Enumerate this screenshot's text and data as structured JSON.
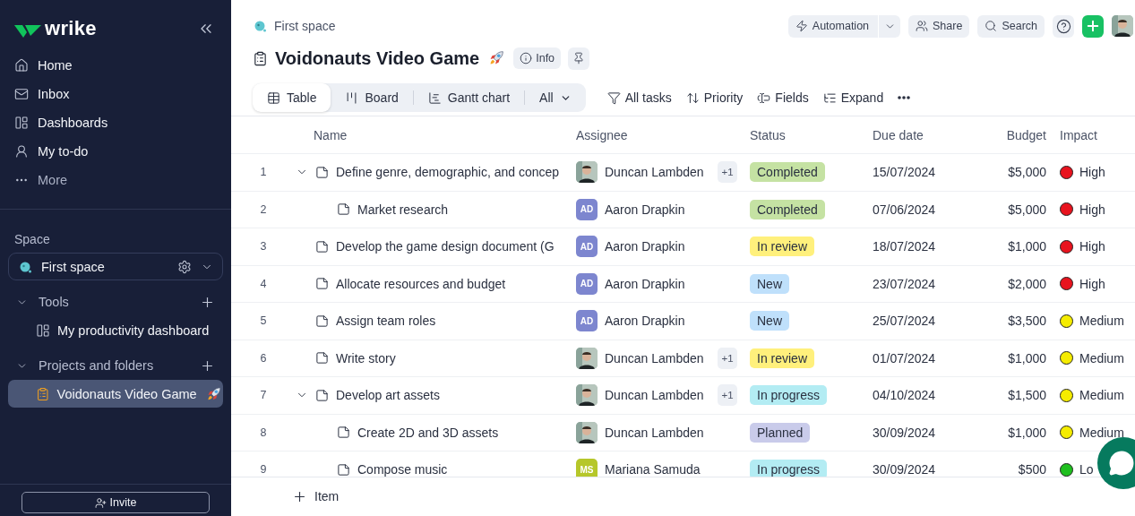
{
  "sidebar": {
    "brand": "wrike",
    "nav": [
      {
        "label": "Home",
        "kind": "home"
      },
      {
        "label": "Inbox",
        "kind": "inbox"
      },
      {
        "label": "Dashboards",
        "kind": "dashboards"
      },
      {
        "label": "My to-do",
        "kind": "todo"
      },
      {
        "label": "More",
        "kind": "more"
      }
    ],
    "space_heading": "Space",
    "space": "First space",
    "sections": [
      {
        "label": "Tools",
        "expanded": true,
        "children": [
          {
            "label": "My productivity dashboard",
            "kind": "dashboard",
            "selected": false
          }
        ]
      },
      {
        "label": "Projects and folders",
        "expanded": true,
        "children": [
          {
            "label": "Voidonauts Video Game",
            "kind": "project",
            "selected": true
          }
        ]
      }
    ],
    "invite": "Invite"
  },
  "header": {
    "breadcrumb": "First space",
    "title": "Voidonauts Video Game",
    "info": "Info",
    "actions": [
      {
        "label": "Automation",
        "kind": "automation"
      },
      {
        "label": "Share",
        "kind": "share"
      },
      {
        "label": "Search",
        "kind": "search"
      }
    ]
  },
  "view_tabs": [
    {
      "label": "Table",
      "kind": "table",
      "selected": true
    },
    {
      "label": "Board",
      "kind": "board",
      "selected": false
    },
    {
      "label": "Gantt chart",
      "kind": "gantt",
      "selected": false
    },
    {
      "label": "All",
      "kind": "menu",
      "selected": false
    }
  ],
  "toolbar": [
    {
      "label": "All tasks",
      "kind": "filter"
    },
    {
      "label": "Priority",
      "kind": "sort"
    },
    {
      "label": "Fields",
      "kind": "fields"
    },
    {
      "label": "Expand",
      "kind": "expand"
    }
  ],
  "table": {
    "columns": [
      "Name",
      "Assignee",
      "Status",
      "Due date",
      "Budget",
      "Impact"
    ],
    "rows": [
      {
        "num": "1",
        "name": "Define genre, demographic, and concep",
        "expanded": true,
        "assignee": {
          "name": "Duncan Lambden"
        },
        "extra": "+1",
        "status": {
          "label": "Completed",
          "color": "#c5e2a3"
        },
        "due": "15/07/2024",
        "budget": "$5,000",
        "impact": {
          "label": "High",
          "color": "#e8131e"
        },
        "children": [
          {
            "num": "2",
            "name": "Market research",
            "assignee": {
              "name": "Aaron Drapkin",
              "kind": "initials",
              "initials": "AD",
              "color": "#7d86cf"
            },
            "status": {
              "label": "Completed",
              "color": "#c5e2a3"
            },
            "due": "07/06/2024",
            "budget": "$5,000",
            "impact": {
              "label": "High",
              "color": "#e8131e"
            }
          }
        ]
      },
      {
        "num": "3",
        "name": "Develop the game design document (G",
        "assignee": {
          "name": "Aaron Drapkin",
          "kind": "initials",
          "initials": "AD",
          "color": "#7d86cf"
        },
        "status": {
          "label": "In review",
          "color": "#fff07c"
        },
        "due": "18/07/2024",
        "budget": "$1,000",
        "impact": {
          "label": "High",
          "color": "#e8131e"
        }
      },
      {
        "num": "4",
        "name": "Allocate resources and budget",
        "assignee": {
          "name": "Aaron Drapkin",
          "kind": "initials",
          "initials": "AD",
          "color": "#7d86cf"
        },
        "status": {
          "label": "New",
          "color": "#bfe0fb"
        },
        "due": "23/07/2024",
        "budget": "$2,000",
        "impact": {
          "label": "High",
          "color": "#e8131e"
        }
      },
      {
        "num": "5",
        "name": "Assign team roles",
        "assignee": {
          "name": "Aaron Drapkin",
          "kind": "initials",
          "initials": "AD",
          "color": "#7d86cf"
        },
        "status": {
          "label": "New",
          "color": "#bfe0fb"
        },
        "due": "25/07/2024",
        "budget": "$3,500",
        "impact": {
          "label": "Medium",
          "color": "#f5ec00"
        }
      },
      {
        "num": "6",
        "name": "Write story",
        "assignee": {
          "name": "Duncan Lambden"
        },
        "extra": "+1",
        "status": {
          "label": "In review",
          "color": "#fff07c"
        },
        "due": "01/07/2024",
        "budget": "$1,000",
        "impact": {
          "label": "Medium",
          "color": "#f5ec00"
        }
      },
      {
        "num": "7",
        "name": "Develop art assets",
        "expanded": true,
        "assignee": {
          "name": "Duncan Lambden"
        },
        "extra": "+1",
        "status": {
          "label": "In progress",
          "color": "#b3ecf3"
        },
        "due": "04/10/2024",
        "budget": "$1,500",
        "impact": {
          "label": "Medium",
          "color": "#f5ec00"
        },
        "children": [
          {
            "num": "8",
            "name": "Create 2D and 3D assets",
            "assignee": {
              "name": "Duncan Lambden"
            },
            "status": {
              "label": "Planned",
              "color": "#c9cbea"
            },
            "due": "30/09/2024",
            "budget": "$1,000",
            "impact": {
              "label": "Medium",
              "color": "#f5ec00"
            }
          },
          {
            "num": "9",
            "name": "Compose music",
            "assignee": {
              "name": "Mariana Samuda",
              "kind": "initials",
              "initials": "MS",
              "color": "#b6c72a"
            },
            "status": {
              "label": "In progress",
              "color": "#b3ecf3"
            },
            "due": "30/09/2024",
            "budget": "$500",
            "impact": {
              "label": "Lo",
              "color": "#1fbf1f"
            }
          }
        ]
      }
    ],
    "add_item": "Item"
  }
}
